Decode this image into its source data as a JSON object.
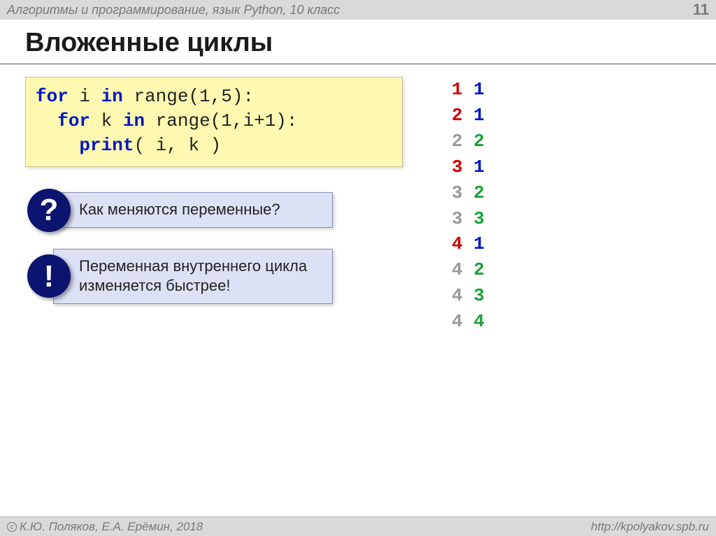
{
  "header": {
    "breadcrumb": "Алгоритмы и программирование, язык Python, 10 класс",
    "pageNumber": "11"
  },
  "title": "Вложенные циклы",
  "code": {
    "line1_kw1": "for",
    "line1_mid": " i ",
    "line1_kw2": "in",
    "line1_rest": " range(1,5):",
    "line2_indent": "  ",
    "line2_kw1": "for",
    "line2_mid": " k ",
    "line2_kw2": "in",
    "line2_rest": " range(1,i+1):",
    "line3_indent": "    ",
    "line3_fn": "print",
    "line3_rest": "( i, k )"
  },
  "callouts": {
    "question_badge": "?",
    "question_text": "Как меняются переменные?",
    "exclaim_badge": "!",
    "exclaim_text": "Переменная внутреннего цикла изменяется быстрее!"
  },
  "output": [
    {
      "i": "1",
      "k": "1",
      "i_first": true,
      "k_first": true
    },
    {
      "i": "2",
      "k": "1",
      "i_first": true,
      "k_first": true
    },
    {
      "i": "2",
      "k": "2",
      "i_first": false,
      "k_first": false
    },
    {
      "i": "3",
      "k": "1",
      "i_first": true,
      "k_first": true
    },
    {
      "i": "3",
      "k": "2",
      "i_first": false,
      "k_first": false
    },
    {
      "i": "3",
      "k": "3",
      "i_first": false,
      "k_first": false
    },
    {
      "i": "4",
      "k": "1",
      "i_first": true,
      "k_first": true
    },
    {
      "i": "4",
      "k": "2",
      "i_first": false,
      "k_first": false
    },
    {
      "i": "4",
      "k": "3",
      "i_first": false,
      "k_first": false
    },
    {
      "i": "4",
      "k": "4",
      "i_first": false,
      "k_first": false
    }
  ],
  "footer": {
    "authors": "К.Ю. Поляков, Е.А. Ерёмин, 2018",
    "url": "http://kpolyakov.spb.ru"
  }
}
